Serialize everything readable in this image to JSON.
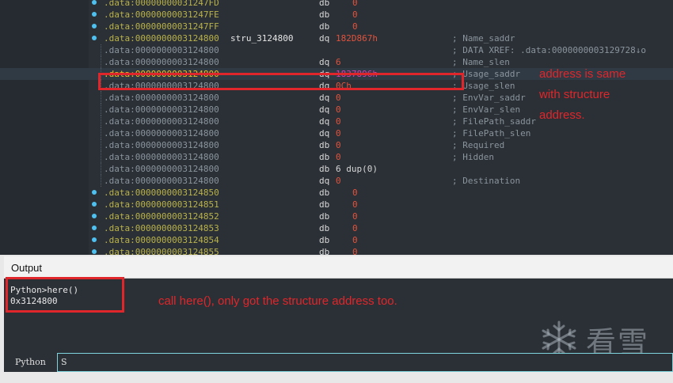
{
  "disasm": {
    "lines": [
      {
        "dot": true,
        "addr": ".data:00000000031247FD",
        "label": "",
        "mn": "db",
        "op": "0",
        "indent": true,
        "cmt": "",
        "kind": "data"
      },
      {
        "dot": true,
        "addr": ".data:00000000031247FE",
        "label": "",
        "mn": "db",
        "op": "0",
        "indent": true,
        "cmt": "",
        "kind": "data"
      },
      {
        "dot": true,
        "addr": ".data:00000000031247FF",
        "label": "",
        "mn": "db",
        "op": "0",
        "indent": true,
        "cmt": "",
        "kind": "data"
      },
      {
        "dot": true,
        "addr": ".data:0000000003124800",
        "label": "stru_3124800",
        "mn": "dq",
        "op": "182D867h",
        "indent": false,
        "cmt": "; Name_saddr",
        "kind": "data"
      },
      {
        "dot": false,
        "addr": ".data:0000000003124800",
        "label": "",
        "mn": "",
        "op": "",
        "indent": false,
        "cmt": "; DATA XREF: .data:0000000003129728↓o",
        "kind": "dim"
      },
      {
        "dot": false,
        "addr": ".data:0000000003124800",
        "label": "",
        "mn": "dq",
        "op": "6",
        "indent": false,
        "cmt": "; Name_slen",
        "kind": "dim"
      },
      {
        "dot": false,
        "addr": ".data:0000000003124800",
        "label": "",
        "mn": "dq",
        "op": "1837896h",
        "indent": false,
        "cmt": "; Usage_saddr",
        "kind": "highlight"
      },
      {
        "dot": false,
        "addr": ".data:0000000003124800",
        "label": "",
        "mn": "dq",
        "op": "0Ch",
        "indent": false,
        "cmt": "; Usage_slen",
        "kind": "dim"
      },
      {
        "dot": false,
        "addr": ".data:0000000003124800",
        "label": "",
        "mn": "dq",
        "op": "0",
        "indent": false,
        "cmt": "; EnvVar_saddr",
        "kind": "dim"
      },
      {
        "dot": false,
        "addr": ".data:0000000003124800",
        "label": "",
        "mn": "dq",
        "op": "0",
        "indent": false,
        "cmt": "; EnvVar_slen",
        "kind": "dim"
      },
      {
        "dot": false,
        "addr": ".data:0000000003124800",
        "label": "",
        "mn": "dq",
        "op": "0",
        "indent": false,
        "cmt": "; FilePath_saddr",
        "kind": "dim"
      },
      {
        "dot": false,
        "addr": ".data:0000000003124800",
        "label": "",
        "mn": "dq",
        "op": "0",
        "indent": false,
        "cmt": "; FilePath_slen",
        "kind": "dim"
      },
      {
        "dot": false,
        "addr": ".data:0000000003124800",
        "label": "",
        "mn": "db",
        "op": "0",
        "indent": false,
        "cmt": "; Required",
        "kind": "dim"
      },
      {
        "dot": false,
        "addr": ".data:0000000003124800",
        "label": "",
        "mn": "db",
        "op": "0",
        "indent": false,
        "cmt": "; Hidden",
        "kind": "dim"
      },
      {
        "dot": false,
        "addr": ".data:0000000003124800",
        "label": "",
        "mn": "db",
        "op": "6 dup(0)",
        "indent": false,
        "cmt": "",
        "kind": "dim"
      },
      {
        "dot": false,
        "addr": ".data:0000000003124800",
        "label": "",
        "mn": "dq",
        "op": "0",
        "indent": false,
        "cmt": "; Destination",
        "kind": "dim"
      },
      {
        "dot": true,
        "addr": ".data:0000000003124850",
        "label": "",
        "mn": "db",
        "op": "0",
        "indent": true,
        "cmt": "",
        "kind": "data"
      },
      {
        "dot": true,
        "addr": ".data:0000000003124851",
        "label": "",
        "mn": "db",
        "op": "0",
        "indent": true,
        "cmt": "",
        "kind": "data"
      },
      {
        "dot": true,
        "addr": ".data:0000000003124852",
        "label": "",
        "mn": "db",
        "op": "0",
        "indent": true,
        "cmt": "",
        "kind": "data"
      },
      {
        "dot": true,
        "addr": ".data:0000000003124853",
        "label": "",
        "mn": "db",
        "op": "0",
        "indent": true,
        "cmt": "",
        "kind": "data"
      },
      {
        "dot": true,
        "addr": ".data:0000000003124854",
        "label": "",
        "mn": "db",
        "op": "0",
        "indent": true,
        "cmt": "",
        "kind": "data"
      },
      {
        "dot": true,
        "addr": ".data:0000000003124855",
        "label": "",
        "mn": "db",
        "op": "0",
        "indent": true,
        "cmt": "",
        "kind": "data"
      }
    ],
    "annotation": [
      "address is same",
      "with structure",
      "address."
    ]
  },
  "output": {
    "title": "Output",
    "lines": [
      "Python>here()",
      "0x3124800"
    ],
    "annotation": "call here(), only got the structure address too."
  },
  "command": {
    "language": "Python",
    "input_value": "S"
  },
  "watermark": {
    "text": "看雪",
    "icon": "snowflake-icon"
  },
  "colors": {
    "annotation_red": "#e0262a",
    "address_yellow": "#b9b24a",
    "operand_red": "#e0533d",
    "highlight_magenta": "#d63fb3",
    "bullet_blue": "#4fc1f0"
  }
}
